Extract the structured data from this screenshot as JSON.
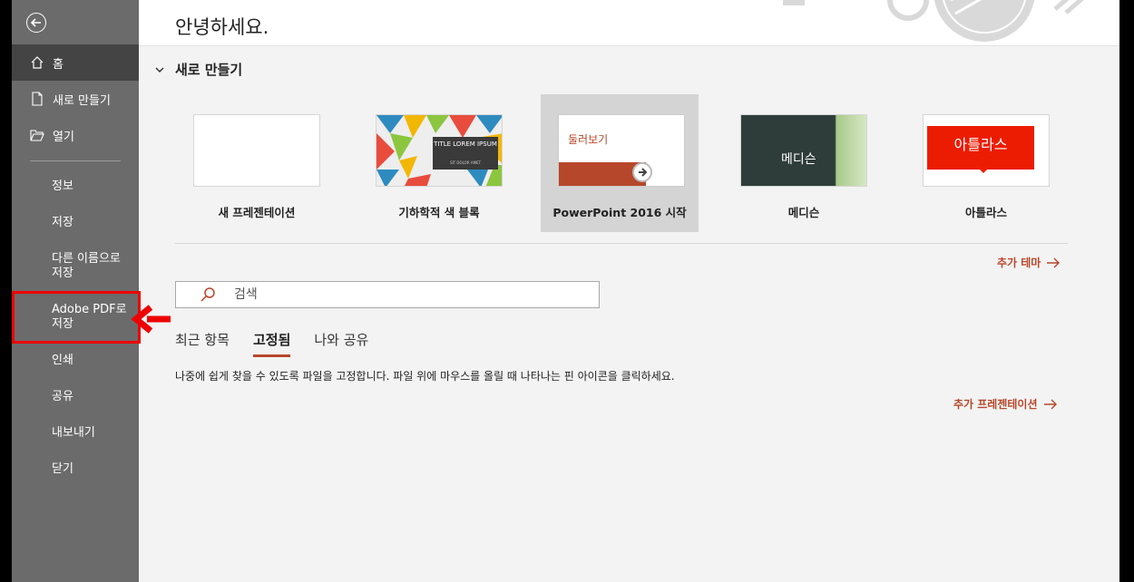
{
  "greeting": "안녕하세요.",
  "sidebar": {
    "back_label": "뒤로",
    "items": [
      {
        "label": "홈",
        "icon": "home-icon"
      },
      {
        "label": "새로 만들기",
        "icon": "new-document-icon"
      },
      {
        "label": "열기",
        "icon": "folder-open-icon"
      },
      {
        "label": "정보"
      },
      {
        "label": "저장"
      },
      {
        "label": "다른 이름으로 저장"
      },
      {
        "label": "Adobe PDF로 저장"
      },
      {
        "label": "인쇄"
      },
      {
        "label": "공유"
      },
      {
        "label": "내보내기"
      },
      {
        "label": "닫기"
      }
    ]
  },
  "new_section": {
    "title": "새로 만들기",
    "templates": [
      {
        "label": "새 프레젠테이션"
      },
      {
        "label": "기하학적 색 블록",
        "thumb_text": "TITLE LOREM IPSUM",
        "thumb_sub": "SIT DOLOR AMET"
      },
      {
        "label": "PowerPoint 2016 시작",
        "thumb_text": "둘러보기"
      },
      {
        "label": "메디슨",
        "thumb_text": "메디슨"
      },
      {
        "label": "아틀라스",
        "thumb_text": "아틀라스"
      }
    ],
    "more_themes": "추가 테마"
  },
  "search": {
    "placeholder": "검색"
  },
  "tabs": [
    {
      "label": "최근 항목"
    },
    {
      "label": "고정됨"
    },
    {
      "label": "나와 공유"
    }
  ],
  "pinned_message": "나중에 쉽게 찾을 수 있도록 파일을 고정합니다. 파일 위에 마우스를 올릴 때 나타나는 핀 아이콘을 클릭하세요.",
  "more_presentations": "추가 프레젠테이션",
  "colors": {
    "accent": "#b7472a",
    "sidebar": "#6b6b6b",
    "highlight": "#e00000"
  }
}
